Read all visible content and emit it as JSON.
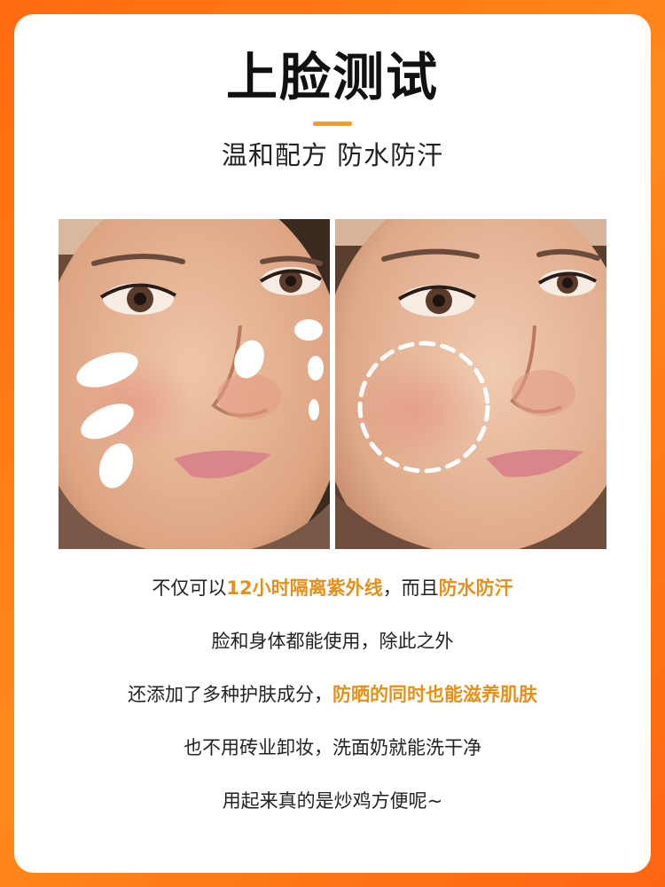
{
  "header": {
    "title": "上脸测试",
    "subtitle": "温和配方 防水防汗"
  },
  "colors": {
    "background": "#ff7316",
    "accent": "#f4a11b",
    "highlight_text": "#e5901b"
  },
  "photos": {
    "before_icon": "face-with-sunscreen-dabs",
    "after_icon": "face-blended-dashed-circle"
  },
  "description": {
    "line1": {
      "pre": "不仅可以",
      "hl1": "12小时隔离紫外线",
      "mid": "，而且",
      "hl2": "防水防汗"
    },
    "line2": "脸和身体都能使用，除此之外",
    "line3": {
      "pre": "还添加了多种护肤成分，",
      "hl": "防晒的同时也能滋养肌肤"
    },
    "line4": "也不用砖业卸妆，洗面奶就能洗干净",
    "line5": "用起来真的是炒鸡方便呢~"
  }
}
